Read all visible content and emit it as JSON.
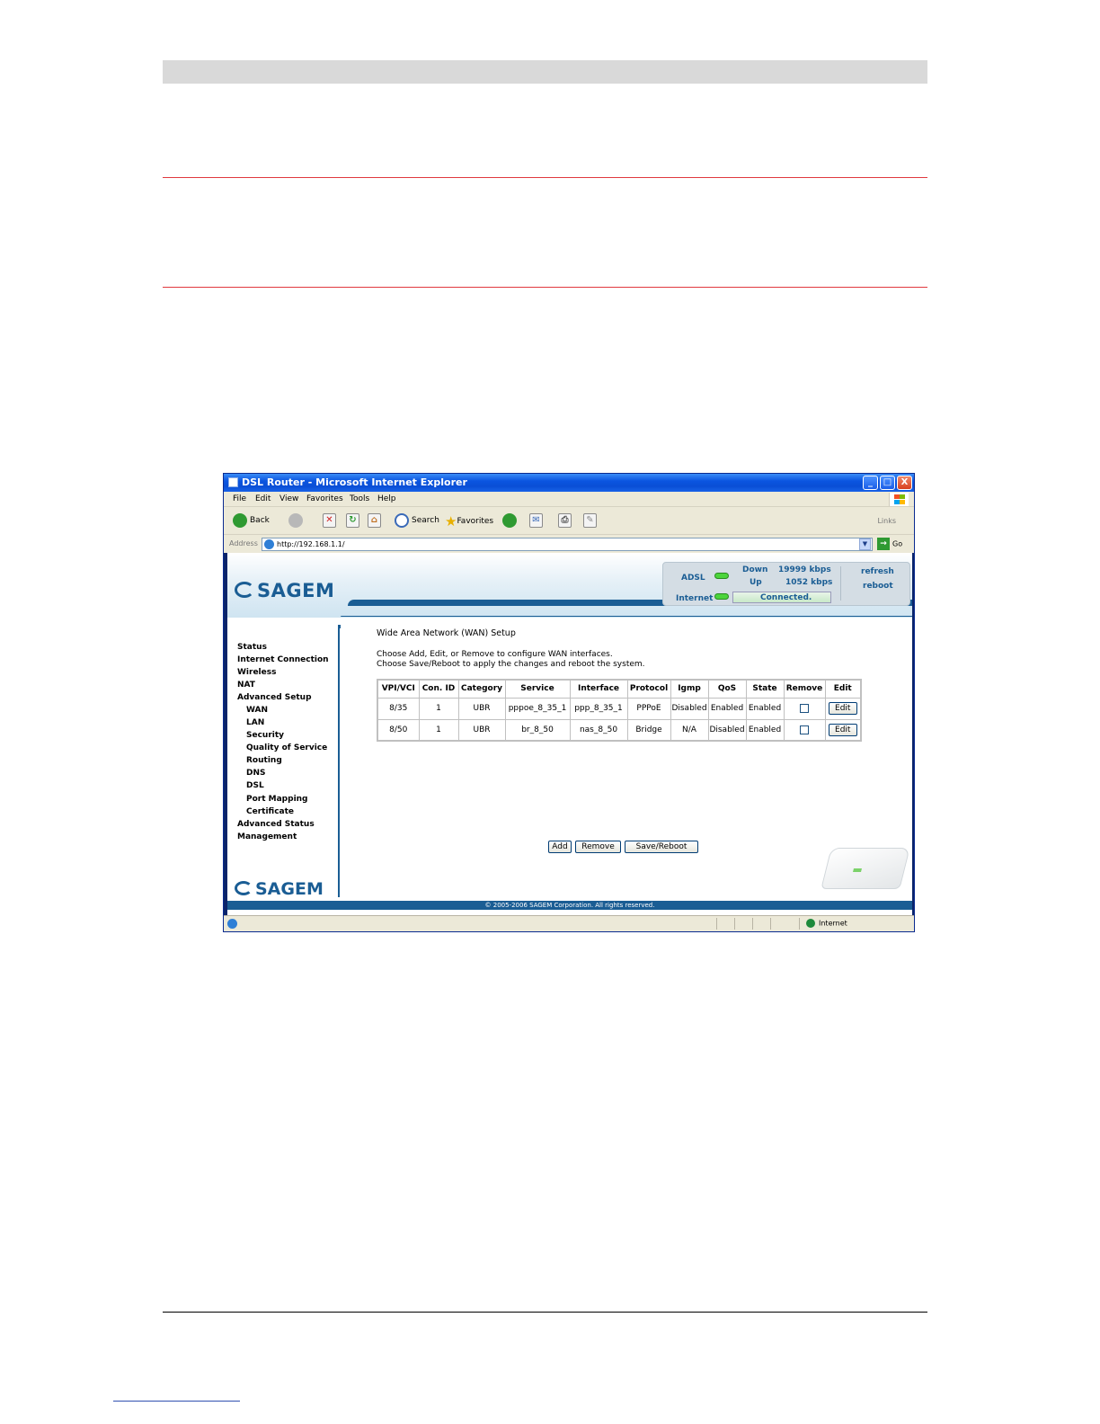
{
  "window": {
    "title": "DSL Router - Microsoft Internet Explorer",
    "minimize": "_",
    "maximize": "□",
    "close": "X"
  },
  "menu": [
    "File",
    "Edit",
    "View",
    "Favorites",
    "Tools",
    "Help"
  ],
  "toolbar": {
    "back": "Back",
    "search": "Search",
    "favorites": "Favorites",
    "links": "Links"
  },
  "address": {
    "label": "Address",
    "value": "http://192.168.1.1/",
    "go": "Go"
  },
  "header": {
    "logo": "SAGEM",
    "adsl_label": "ADSL",
    "internet_label": "Internet",
    "down_label": "Down",
    "down_value": "19999 kbps",
    "up_label": "Up",
    "up_value": "1052 kbps",
    "connection_status": "Connected.",
    "refresh": "refresh",
    "reboot": "reboot"
  },
  "nav": {
    "items": [
      {
        "label": "Status",
        "sub": false
      },
      {
        "label": "Internet Connection",
        "sub": false
      },
      {
        "label": "Wireless",
        "sub": false
      },
      {
        "label": "NAT",
        "sub": false
      },
      {
        "label": "Advanced Setup",
        "sub": false
      },
      {
        "label": "WAN",
        "sub": true
      },
      {
        "label": "LAN",
        "sub": true
      },
      {
        "label": "Security",
        "sub": true
      },
      {
        "label": "Quality of Service",
        "sub": true
      },
      {
        "label": "Routing",
        "sub": true
      },
      {
        "label": "DNS",
        "sub": true
      },
      {
        "label": "DSL",
        "sub": true
      },
      {
        "label": "Port Mapping",
        "sub": true
      },
      {
        "label": "Certificate",
        "sub": true
      },
      {
        "label": "Advanced Status",
        "sub": false
      },
      {
        "label": "Management",
        "sub": false
      }
    ],
    "footer_logo": "SAGEM"
  },
  "main": {
    "title": "Wide Area Network (WAN) Setup",
    "instruction_1": "Choose Add, Edit, or Remove to configure WAN interfaces.",
    "instruction_2": "Choose Save/Reboot to apply the changes and reboot the system.",
    "table": {
      "headers": [
        "VPI/VCI",
        "Con. ID",
        "Category",
        "Service",
        "Interface",
        "Protocol",
        "Igmp",
        "QoS",
        "State",
        "Remove",
        "Edit"
      ],
      "rows": [
        {
          "vpi_vci": "8/35",
          "con_id": "1",
          "category": "UBR",
          "service": "pppoe_8_35_1",
          "interface": "ppp_8_35_1",
          "protocol": "PPPoE",
          "igmp": "Disabled",
          "qos": "Enabled",
          "state": "Enabled",
          "edit": "Edit"
        },
        {
          "vpi_vci": "8/50",
          "con_id": "1",
          "category": "UBR",
          "service": "br_8_50",
          "interface": "nas_8_50",
          "protocol": "Bridge",
          "igmp": "N/A",
          "qos": "Disabled",
          "state": "Enabled",
          "edit": "Edit"
        }
      ]
    },
    "buttons": {
      "add": "Add",
      "remove": "Remove",
      "save_reboot": "Save/Reboot"
    }
  },
  "footer": {
    "copyright": "© 2005-2006 SAGEM Corporation. All rights reserved."
  },
  "statusbar": {
    "zone": "Internet"
  },
  "colors": {
    "brand_blue": "#1a5d94",
    "doc_rule_red": "#e0393e",
    "led_green": "#4cd43c"
  }
}
